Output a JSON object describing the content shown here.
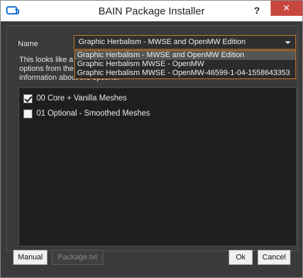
{
  "window": {
    "title": "BAIN Package Installer",
    "help_label": "?",
    "close_label": "✕"
  },
  "form": {
    "name_label": "Name",
    "selected_value": "Graphic Herbalism - MWSE and OpenMW Edition",
    "info_lines": [
      "This looks like a F",
      "options from the",
      "information about the options."
    ]
  },
  "dropdown": {
    "options": [
      "Graphic Herbalism - MWSE and OpenMW Edition",
      "Graphic Herbalism MWSE - OpenMW",
      "Graphic Herbalism MWSE - OpenMW-46599-1-04-1558643353"
    ]
  },
  "options_list": [
    {
      "label": "00 Core + Vanilla Meshes",
      "checked": true
    },
    {
      "label": "01 Optional - Smoothed Meshes",
      "checked": false
    }
  ],
  "buttons": {
    "manual": "Manual",
    "package_txt": "Package.txt",
    "ok": "Ok",
    "cancel": "Cancel"
  },
  "colors": {
    "accent_border": "#c87a2a",
    "close_button": "#c7463e",
    "app_icon": "#1a6fd0"
  }
}
